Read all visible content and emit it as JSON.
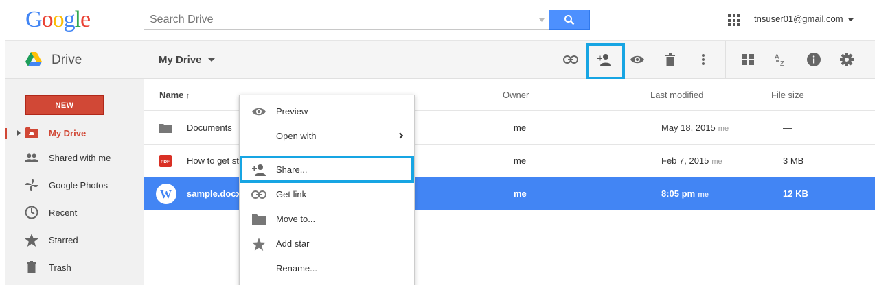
{
  "topbar": {
    "logo": "Google",
    "search_placeholder": "Search Drive",
    "account": "tnsuser01@gmail.com"
  },
  "toolbar": {
    "app_name": "Drive",
    "location": "My Drive",
    "icons": [
      "link-icon",
      "add-person-icon",
      "eye-icon",
      "trash-icon",
      "more-vert-icon",
      "grid-view-icon",
      "sort-az-icon",
      "info-icon",
      "gear-icon"
    ]
  },
  "sidebar": {
    "new_label": "NEW",
    "items": [
      {
        "label": "My Drive",
        "icon": "drive-folder-icon",
        "active": true
      },
      {
        "label": "Shared with me",
        "icon": "people-icon"
      },
      {
        "label": "Google Photos",
        "icon": "pinwheel-icon"
      },
      {
        "label": "Recent",
        "icon": "clock-icon"
      },
      {
        "label": "Starred",
        "icon": "star-icon"
      },
      {
        "label": "Trash",
        "icon": "trash-icon"
      }
    ]
  },
  "filelist": {
    "headers": {
      "name": "Name",
      "owner": "Owner",
      "modified": "Last modified",
      "size": "File size"
    },
    "rows": [
      {
        "name": "Documents",
        "type": "folder",
        "owner": "me",
        "modified": "May 18, 2015",
        "modified_by": "me",
        "size": "—"
      },
      {
        "name": "How to get st",
        "type": "pdf",
        "owner": "me",
        "modified": "Feb 7, 2015",
        "modified_by": "me",
        "size": "3 MB"
      },
      {
        "name": "sample.docx",
        "type": "word",
        "owner": "me",
        "modified": "8:05 pm",
        "modified_by": "me",
        "size": "12 KB",
        "selected": true
      }
    ]
  },
  "context_menu": {
    "items": [
      {
        "label": "Preview",
        "icon": "eye-icon"
      },
      {
        "label": "Open with",
        "icon": "",
        "submenu": true
      },
      {
        "label": "Share...",
        "icon": "add-person-icon"
      },
      {
        "label": "Get link",
        "icon": "link-icon"
      },
      {
        "label": "Move to...",
        "icon": "folder-icon"
      },
      {
        "label": "Add star",
        "icon": "star-icon"
      },
      {
        "label": "Rename...",
        "icon": ""
      }
    ]
  },
  "colors": {
    "accent_blue": "#4285f4",
    "new_red": "#d14836",
    "highlight": "#17a5e3"
  }
}
